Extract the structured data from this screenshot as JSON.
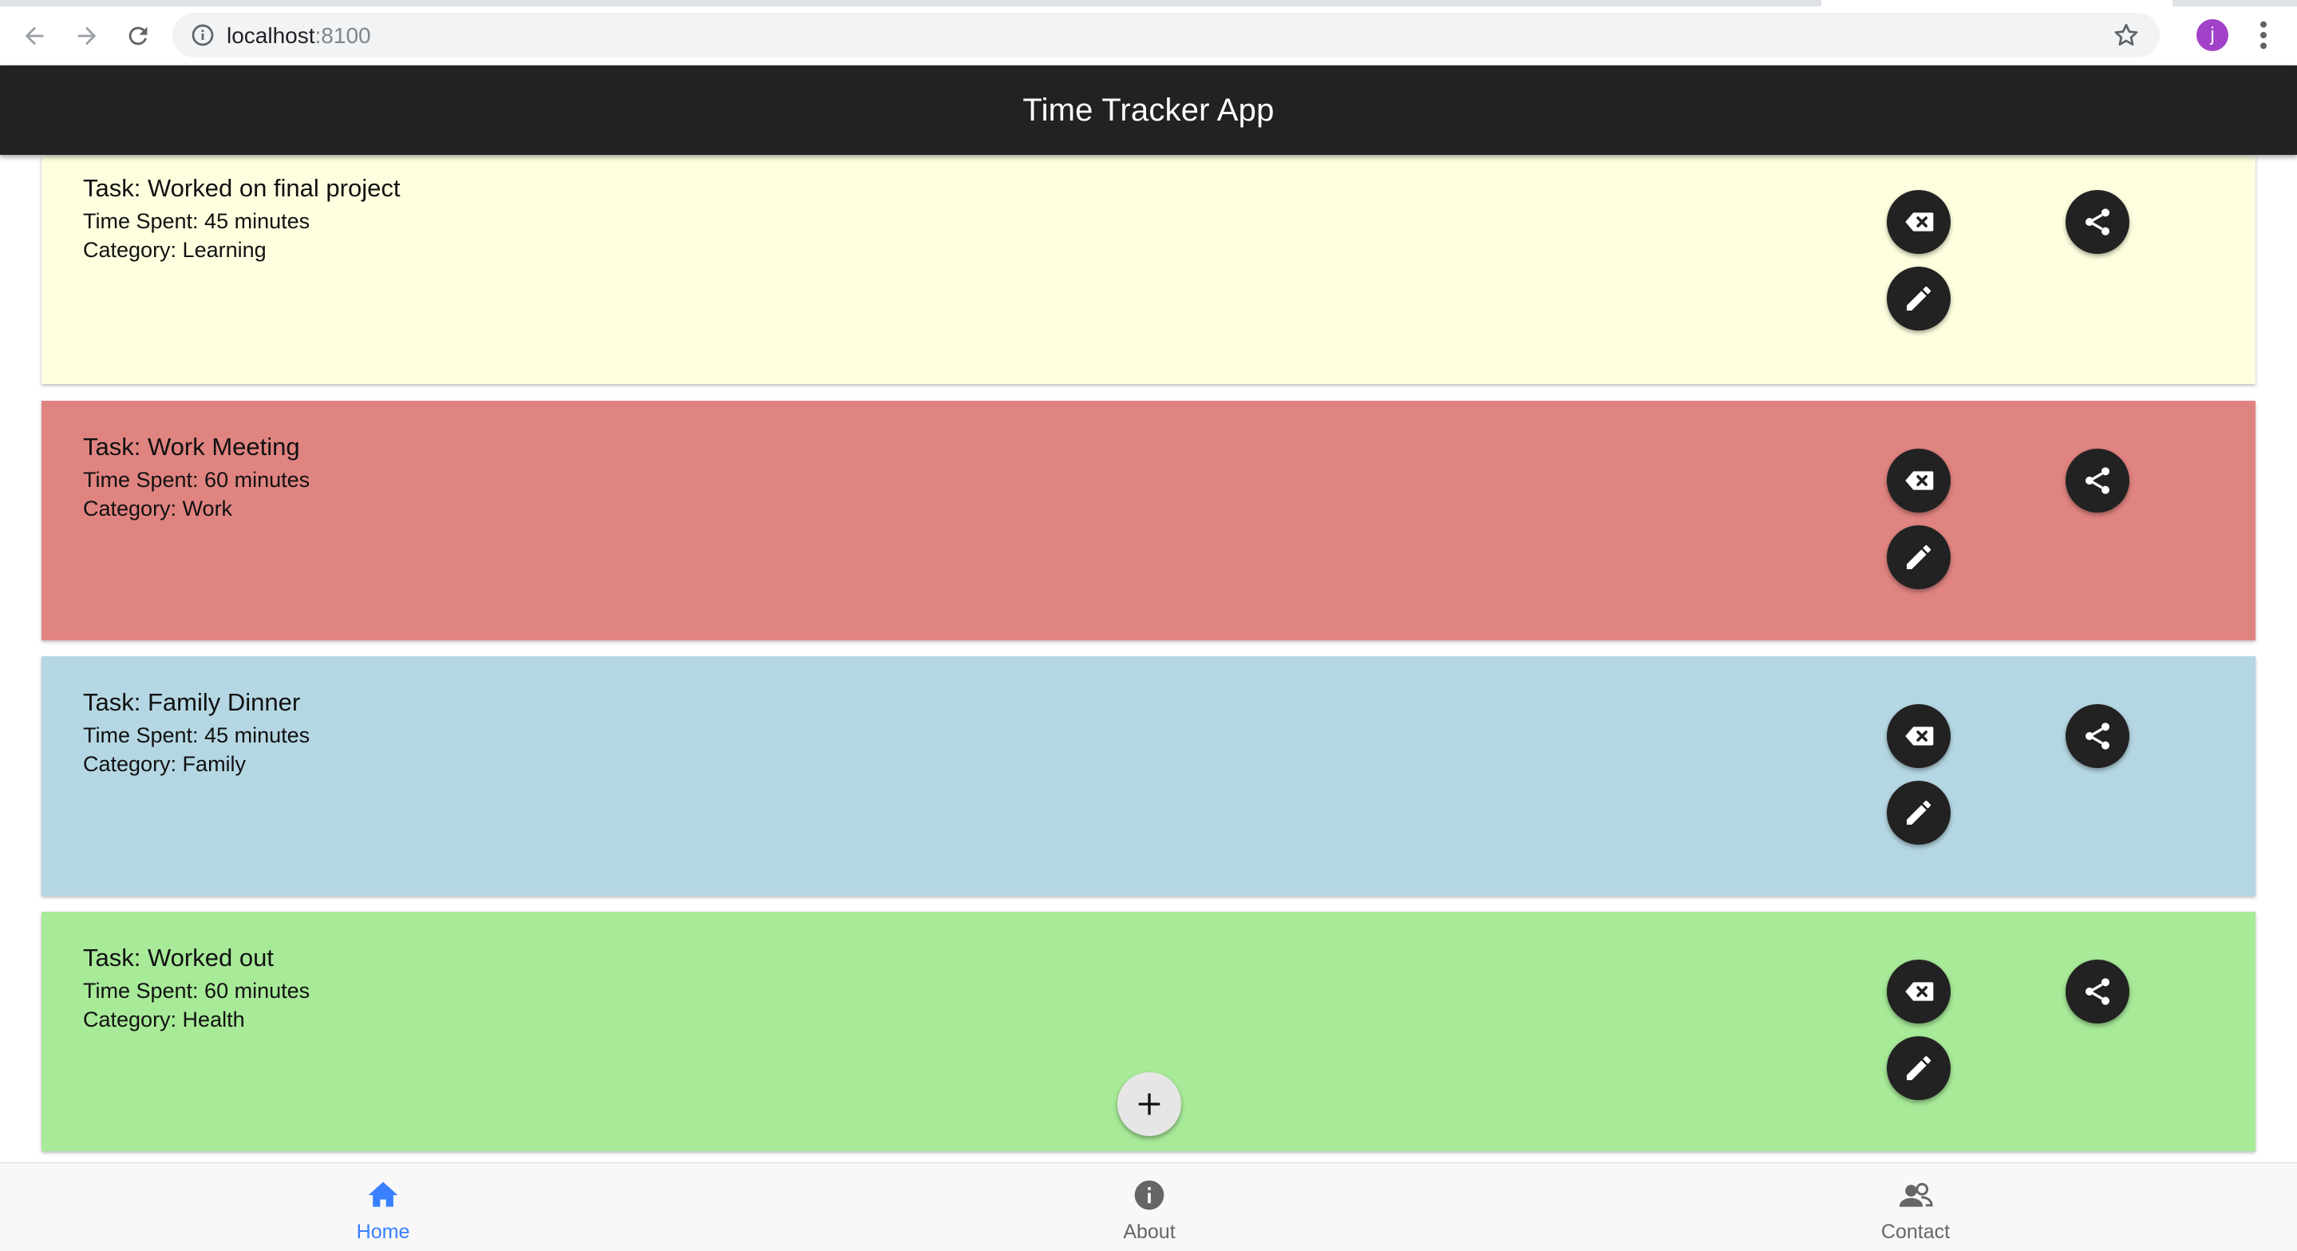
{
  "browser": {
    "url_host": "localhost",
    "url_port": ":8100",
    "avatar_letter": "j"
  },
  "header": {
    "title": "Time Tracker App"
  },
  "tasks": [
    {
      "task": "Task: Worked on final project",
      "time": "Time Spent: 45 minutes",
      "category": "Category: Learning",
      "color": "#ffffe0"
    },
    {
      "task": "Task: Work Meeting",
      "time": "Time Spent: 60 minutes",
      "category": "Category: Work",
      "color": "#e08481"
    },
    {
      "task": "Task: Family Dinner",
      "time": "Time Spent: 45 minutes",
      "category": "Category: Family",
      "color": "#b5d7e3"
    },
    {
      "task": "Task: Worked out",
      "time": "Time Spent: 60 minutes",
      "category": "Category: Health",
      "color": "#a7ea98"
    }
  ],
  "icons": {
    "delete": "backspace-icon",
    "edit": "pencil-icon",
    "share": "share-icon",
    "add": "plus-icon"
  },
  "tabs": [
    {
      "label": "Home",
      "icon": "home-icon",
      "selected": true
    },
    {
      "label": "About",
      "icon": "info-icon",
      "selected": false
    },
    {
      "label": "Contact",
      "icon": "people-icon",
      "selected": false
    }
  ],
  "colors": {
    "header_bg": "#222222",
    "tab_selected": "#3880ff",
    "tab_unselected": "#666666"
  }
}
